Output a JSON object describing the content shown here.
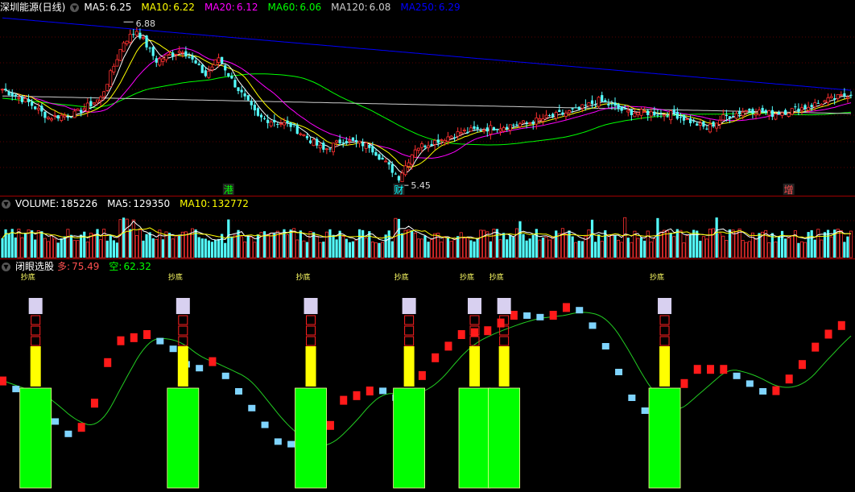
{
  "chart_data": [
    {
      "type": "candlestick",
      "title": "深圳能源(日线)",
      "indicators": [
        {
          "label": "MA5:",
          "value": "6.25",
          "color": "#ffffff"
        },
        {
          "label": "MA10:",
          "value": "6.22",
          "color": "#ffff00"
        },
        {
          "label": "MA20:",
          "value": "6.12",
          "color": "#ff00ff"
        },
        {
          "label": "MA60:",
          "value": "6.06",
          "color": "#00ff00"
        },
        {
          "label": "MA120:",
          "value": "6.08",
          "color": "#cccccc"
        },
        {
          "label": "MA250:",
          "value": "6.29",
          "color": "#0000ff"
        }
      ],
      "ylim": [
        5.38,
        6.96
      ],
      "annotations": {
        "high": "6.88",
        "low": "5.45"
      },
      "event_markers": [
        {
          "label": "港",
          "index": 69,
          "color": "#00ff00"
        },
        {
          "label": "财",
          "index": 121,
          "color": "#00ffff"
        },
        {
          "label": "增",
          "index": 240,
          "color": "#ff5050"
        }
      ],
      "colors": {
        "up": "#ff3030",
        "down": "#54ffff"
      }
    },
    {
      "type": "bar",
      "title": "VOLUME:",
      "indicators": [
        {
          "label": "VOLUME:",
          "value": "185226",
          "color": "#ffffff"
        },
        {
          "label": "MA5:",
          "value": "129350",
          "color": "#ffffff"
        },
        {
          "label": "MA10:",
          "value": "132772",
          "color": "#ffff00"
        }
      ]
    },
    {
      "type": "custom",
      "title": "闭眼选股",
      "indicators": [
        {
          "label": "多:",
          "value": "75.49",
          "color": "#ff5050"
        },
        {
          "label": "空:",
          "value": "62.32",
          "color": "#00ff00"
        }
      ],
      "signal_label": "抄底",
      "ylim": [
        0,
        100
      ]
    }
  ]
}
